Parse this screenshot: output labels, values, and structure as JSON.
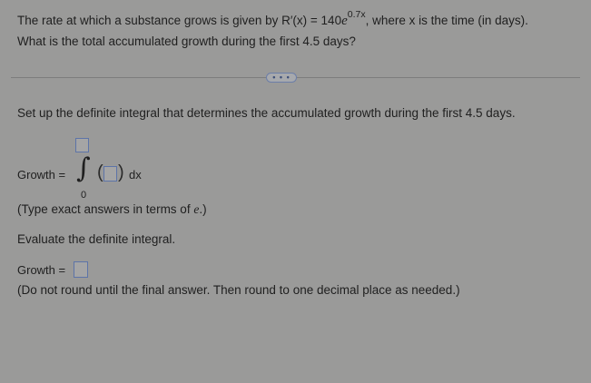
{
  "question": {
    "line1_prefix": "The rate at which a substance grows is given by R′(x) = 140",
    "line1_base": "e",
    "line1_exponent": "0.7x",
    "line1_suffix": ", where x is the time (in days).",
    "line2": "What is the total accumulated growth during the first 4.5 days?"
  },
  "divider": {
    "more_label": "• • •"
  },
  "part1": {
    "instruction": "Set up the definite integral that determines the accumulated growth during the first 4.5 days.",
    "growth_label": "Growth =",
    "integral_symbol": "∫",
    "lower_limit": "0",
    "paren_open": "(",
    "paren_close": ")",
    "differential": "dx",
    "note_prefix": "(Type exact answers in terms of ",
    "note_e": "e",
    "note_suffix": ".)"
  },
  "part2": {
    "instruction": "Evaluate the definite integral.",
    "growth_label": "Growth =",
    "note": "(Do not round until the final answer. Then round to one decimal place as needed.)"
  }
}
